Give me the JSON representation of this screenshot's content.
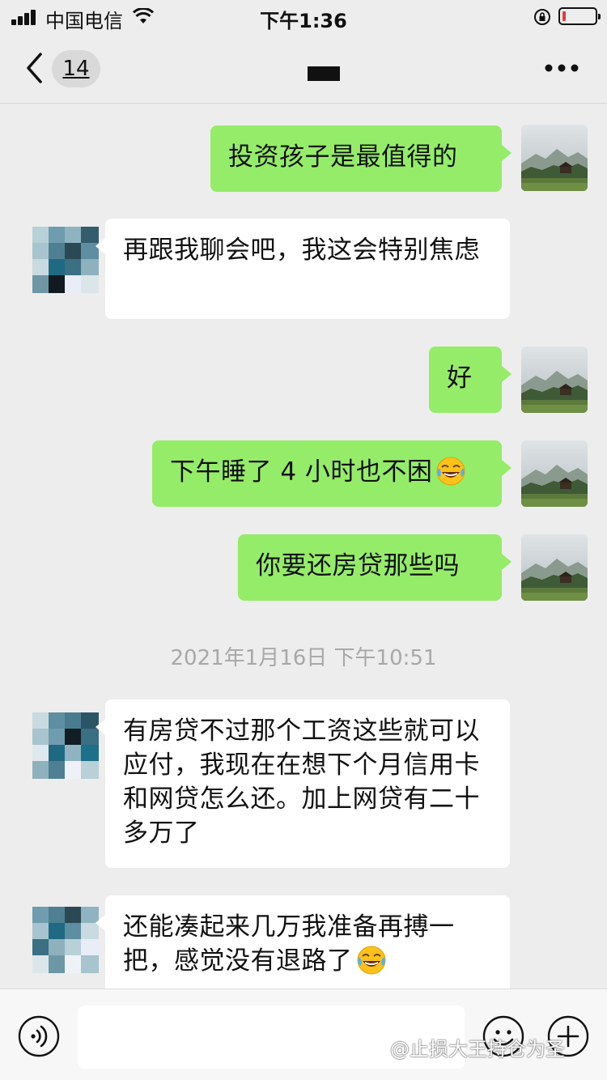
{
  "status_bar": {
    "carrier": "中国电信",
    "time": "下午1:36"
  },
  "nav": {
    "unread_count": "14"
  },
  "messages": [
    {
      "side": "me",
      "text": "投资孩子是最值得的"
    },
    {
      "side": "them",
      "text": "再跟我聊会吧，我这会特别焦虑"
    },
    {
      "side": "me",
      "text": "好"
    },
    {
      "side": "me",
      "text": "下午睡了 4 小时也不困",
      "emoji": "face-with-tears-of-joy"
    },
    {
      "side": "me",
      "text": "你要还房贷那些吗"
    },
    {
      "side": "them",
      "text": "有房贷不过那个工资这些就可以应付，我现在在想下个月信用卡和网贷怎么还。加上网贷有二十多万了"
    },
    {
      "side": "them",
      "text": "还能凑起来几万我准备再搏一把，感觉没有退路了",
      "emoji": "face-with-tears-of-joy"
    }
  ],
  "timestamp": "2021年1月16日 下午10:51",
  "watermark": "@止损大王持仓为圣",
  "colors": {
    "background": "#ededed",
    "my_bubble": "#95ec69",
    "their_bubble": "#ffffff"
  },
  "icons": {
    "signal": "cell-signal-icon",
    "wifi": "wifi-icon",
    "rotation_lock": "rotation-lock-icon",
    "battery": "battery-low-icon",
    "back": "chevron-left-icon",
    "more": "more-dots-icon",
    "voice": "voice-icon",
    "emoji": "emoji-icon",
    "plus": "plus-icon"
  }
}
